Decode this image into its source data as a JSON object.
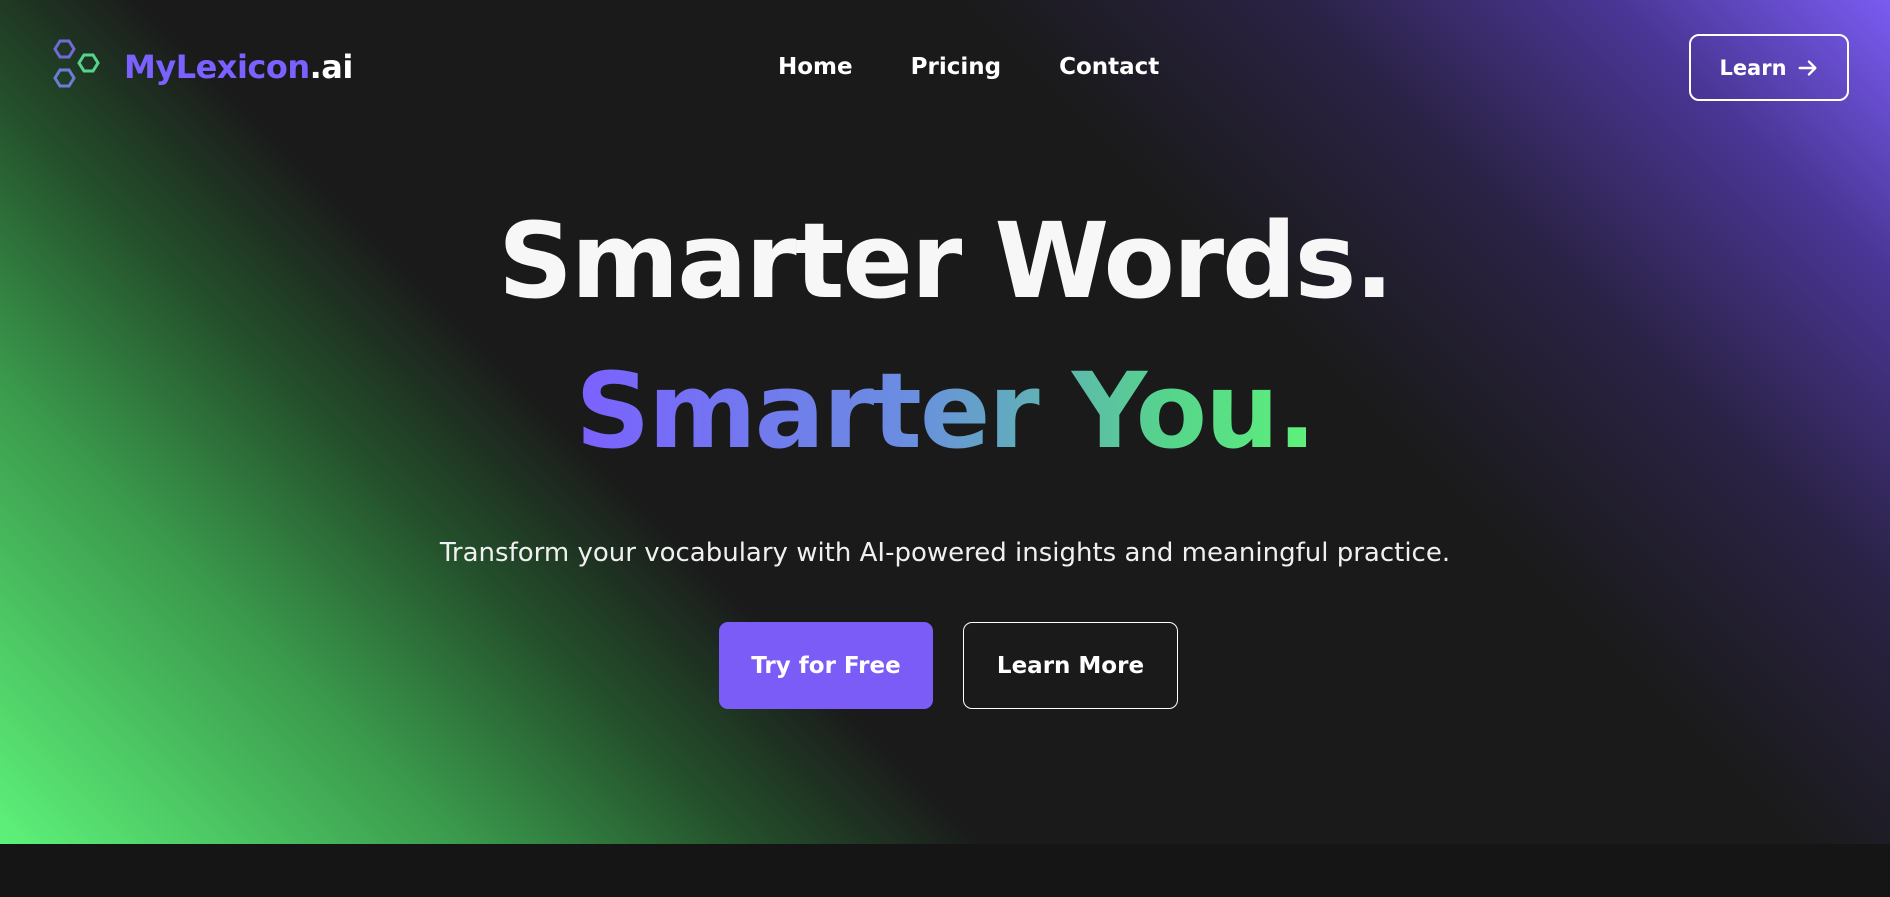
{
  "colors": {
    "accent": "#7b61ff",
    "green": "#5ef27a",
    "background": "#1a1a1a"
  },
  "logo": {
    "brand": "MyLexicon",
    "tld": ".ai",
    "icon": "hexagons-icon"
  },
  "nav": {
    "items": [
      "Home",
      "Pricing",
      "Contact"
    ]
  },
  "header_button": {
    "label": "Learn",
    "icon": "arrow-right-icon"
  },
  "hero": {
    "line1": "Smarter Words.",
    "line2": "Smarter You.",
    "subtitle": "Transform your vocabulary with AI-powered insights and meaningful practice.",
    "primary_cta": "Try for Free",
    "secondary_cta": "Learn More"
  }
}
